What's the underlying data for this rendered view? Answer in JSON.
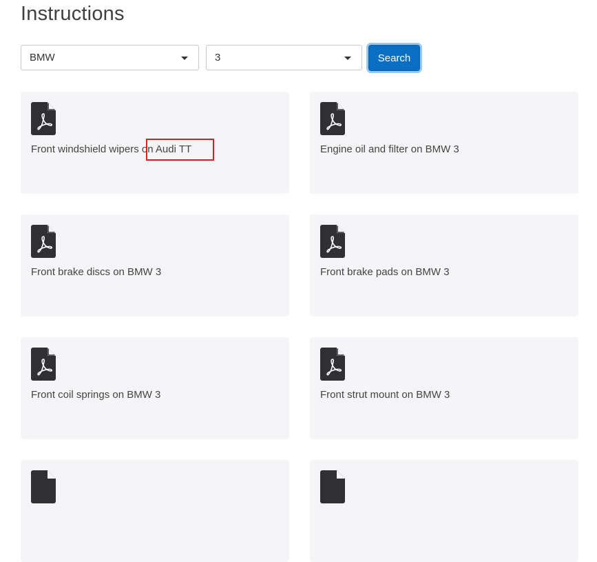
{
  "page": {
    "title": "Instructions"
  },
  "filters": {
    "make_selected": "BMW",
    "model_selected": "3",
    "search_label": "Search"
  },
  "cards": [
    {
      "title": "Front windshield wipers on Audi TT",
      "icon": "pdf-icon"
    },
    {
      "title": "Engine oil and filter on BMW 3",
      "icon": "pdf-icon"
    },
    {
      "title": "Front brake discs on BMW 3",
      "icon": "pdf-icon"
    },
    {
      "title": "Front brake pads on BMW 3",
      "icon": "pdf-icon"
    },
    {
      "title": "Front coil springs on BMW 3",
      "icon": "pdf-icon"
    },
    {
      "title": "Front strut mount on BMW 3",
      "icon": "pdf-icon"
    }
  ],
  "colors": {
    "accent": "#0a6fc2",
    "card_background": "#f5f5f7",
    "highlight": "#d81e1e"
  }
}
